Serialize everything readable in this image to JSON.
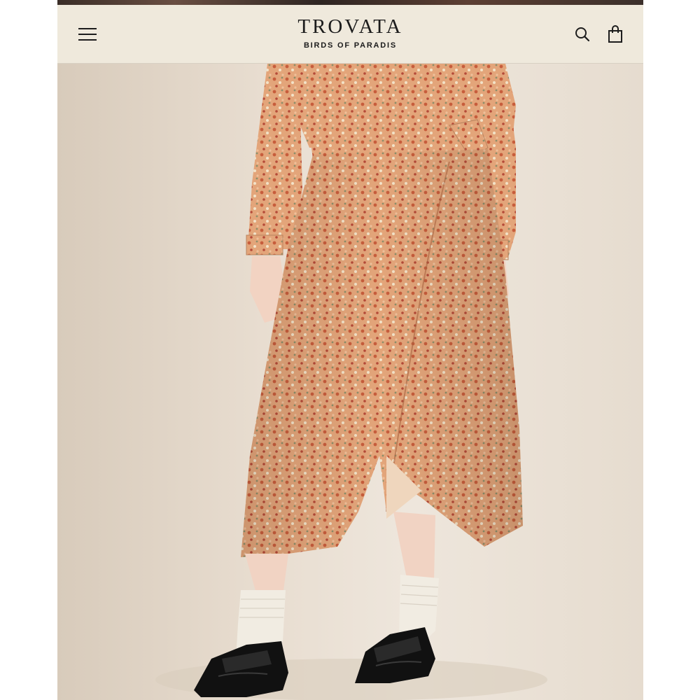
{
  "header": {
    "brand_title": "TROVATA",
    "brand_subtitle": "BIRDS OF PARADIS",
    "menu_icon": "hamburger-menu-icon",
    "search_icon": "search-icon",
    "cart_icon": "shopping-bag-icon"
  },
  "colors": {
    "header_bg": "#efe9dc",
    "dress_base": "#e0a277",
    "dress_print": "#c8643f",
    "backdrop": "#e9e1d6",
    "shoes": "#111111",
    "socks": "#f1ece2"
  },
  "hero": {
    "image_alt": ""
  }
}
